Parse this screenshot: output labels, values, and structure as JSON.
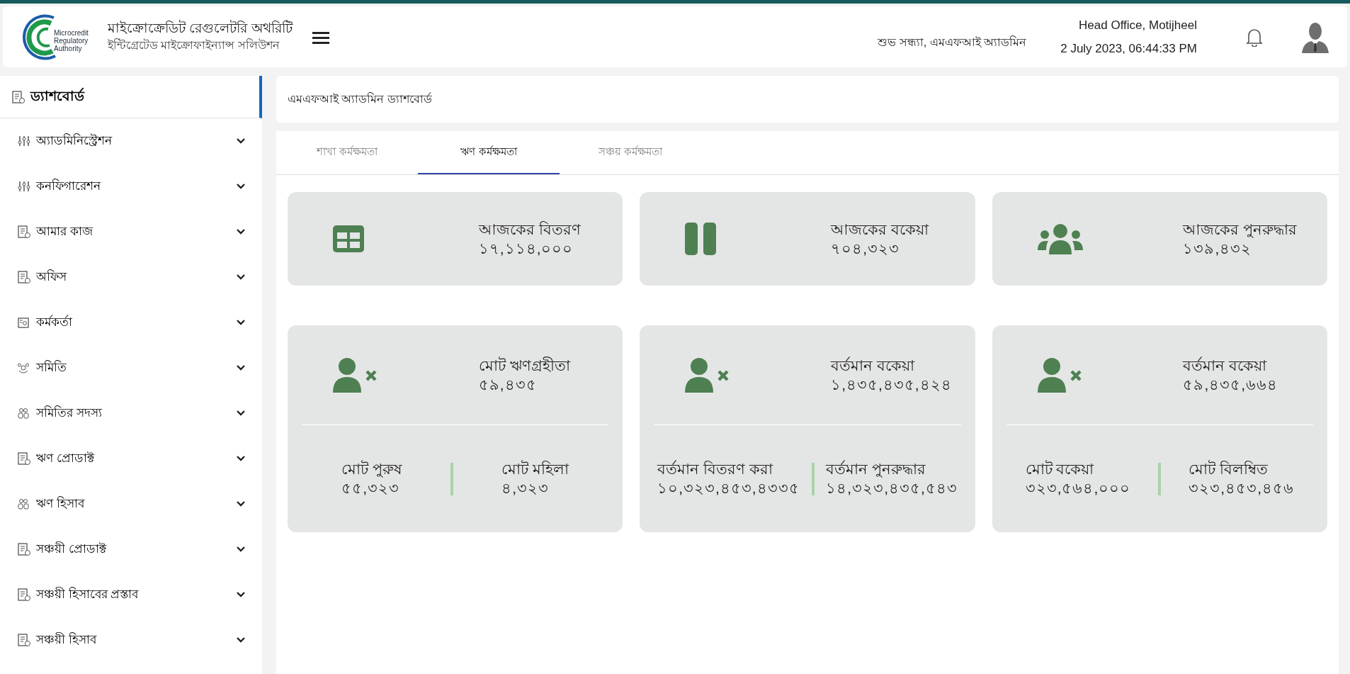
{
  "header": {
    "logo_lines": [
      "Microcredit",
      "Regulatory",
      "Authority"
    ],
    "title": "মাইক্রোক্রেডিট রেগুলেটরি অথরিটি",
    "subtitle": "ইন্টিগ্রেটেড মাইক্রোফাইন্যান্স সলিউশন",
    "greeting": "শুভ সন্ধ্যা, এমএফআই অ্যাডমিন",
    "office": "Head Office, Motijheel",
    "datetime": "2 July 2023, 06:44:33 PM"
  },
  "sidebar": {
    "header": {
      "label": "ড্যাশবোর্ড",
      "selected": true
    },
    "items": [
      {
        "label": "অ্যাডমিনিস্ট্রেশন",
        "kind": "sliders",
        "expanded": false
      },
      {
        "label": "কনফিগারেশন",
        "kind": "sliders",
        "expanded": false
      },
      {
        "label": "আমার কাজ",
        "kind": "page",
        "expanded": false
      },
      {
        "label": "অফিস",
        "kind": "page",
        "expanded": false
      },
      {
        "label": "কর্মকর্তা",
        "kind": "staff",
        "expanded": false
      },
      {
        "label": "সমিতি",
        "kind": "society",
        "expanded": false
      },
      {
        "label": "সমিতির সদস্য",
        "kind": "members",
        "expanded": false
      },
      {
        "label": "ঋণ প্রোডাক্ট",
        "kind": "page",
        "expanded": false
      },
      {
        "label": "ঋণ হিসাব",
        "kind": "members",
        "expanded": false
      },
      {
        "label": "সঞ্চয়ী প্রোডাক্ট",
        "kind": "page",
        "expanded": false
      },
      {
        "label": "সঞ্চয়ী হিসাবের প্রস্তাব",
        "kind": "page",
        "expanded": false
      },
      {
        "label": "সঞ্চয়ী হিসাব",
        "kind": "page",
        "expanded": false
      }
    ]
  },
  "breadcrumb": "এমএফআই অ্যাডমিন ড্যাশবোর্ড",
  "tabs": [
    {
      "label": "শাখা কর্মক্ষমতা",
      "selected": false
    },
    {
      "label": "ঋণ কর্মক্ষমতা",
      "selected": true
    },
    {
      "label": "সঞ্চয় কর্মক্ষমতা",
      "selected": false
    }
  ],
  "stats": [
    {
      "kind": "grid",
      "label": "আজকের বিতরণ",
      "value": "১৭,১১৪,০০০"
    },
    {
      "kind": "columns",
      "label": "আজকের বকেয়া",
      "value": "৭০৪,৩২৩"
    },
    {
      "kind": "group",
      "label": "আজকের পুনরুদ্ধার",
      "value": "১৩৯,৪৩২"
    }
  ],
  "summaries": [
    {
      "label": "মোট ঋণগ্রহীতা",
      "value": "৫৯,৪৩৫",
      "left": {
        "label": "মোট পুরুষ",
        "value": "৫৫,৩২৩"
      },
      "right": {
        "label": "মোট মহিলা",
        "value": "৪,৩২৩"
      }
    },
    {
      "label": "বর্তমান বকেয়া",
      "value": "১,৪৩৫,৪৩৫,৪২৪",
      "left": {
        "label": "বর্তমান বিতরণ করা",
        "value": "১০,৩২৩,৪৫৩,৪৩৩৫"
      },
      "right": {
        "label": "বর্তমান পুনরুদ্ধার",
        "value": "১৪,৩২৩,৪৩৫,৫৪৩"
      }
    },
    {
      "label": "বর্তমান বকেয়া",
      "value": "৫৯,৪৩৫,৬৬৪",
      "left": {
        "label": "মোট বকেয়া",
        "value": "৩২৩,৫৬৪,০০০"
      },
      "right": {
        "label": "মোট বিলম্বিত",
        "value": "৩২৩,৪৫৩,৪৫৬"
      }
    }
  ]
}
